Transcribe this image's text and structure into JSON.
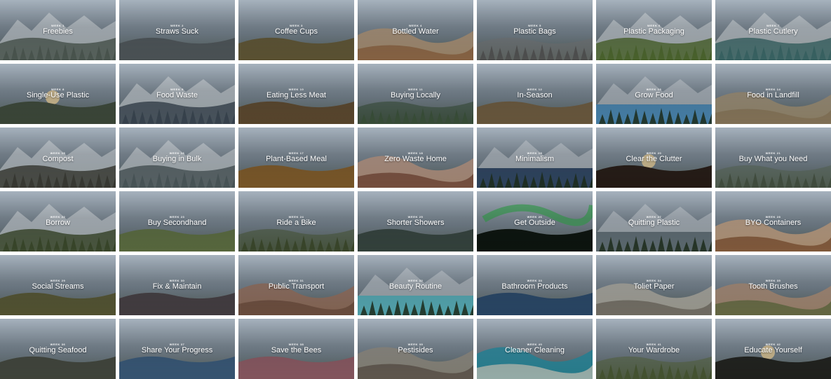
{
  "tiles": [
    {
      "week": "WEEK 1",
      "title": "Freebies",
      "scene": "snow-peaks",
      "colors": [
        "#b9c6d3",
        "#7c8a96",
        "#4f5b54"
      ]
    },
    {
      "week": "WEEK 2",
      "title": "Straws Suck",
      "scene": "foggy-lake",
      "colors": [
        "#dfe3e6",
        "#9aa5ab",
        "#2e3437"
      ]
    },
    {
      "week": "WEEK 3",
      "title": "Coffee Cups",
      "scene": "valley-road",
      "colors": [
        "#8fa6b0",
        "#7e7a4a",
        "#5a4a2a"
      ]
    },
    {
      "week": "WEEK 4",
      "title": "Bottled Water",
      "scene": "desert-hoodoo",
      "colors": [
        "#4f7ca6",
        "#c9a27a",
        "#8b5e3b"
      ]
    },
    {
      "week": "WEEK 5",
      "title": "Plastic Bags",
      "scene": "bw-forest",
      "colors": [
        "#d2d2d2",
        "#7b7b7b",
        "#2a2a2a"
      ]
    },
    {
      "week": "WEEK 6",
      "title": "Plastic Packaging",
      "scene": "mountain-meadow",
      "colors": [
        "#8eb6d8",
        "#7a8a96",
        "#4f6a2e"
      ]
    },
    {
      "week": "WEEK 7",
      "title": "Plastic Cutlery",
      "scene": "mountain-river",
      "colors": [
        "#d6dde3",
        "#6f7e77",
        "#3b6a6a"
      ]
    },
    {
      "week": "WEEK 8",
      "title": "Single-Use Plastic",
      "scene": "beach-sunset",
      "colors": [
        "#d8c9b8",
        "#8fa4b2",
        "#3e4a3a"
      ]
    },
    {
      "week": "WEEK 9",
      "title": "Food Waste",
      "scene": "glacier",
      "colors": [
        "#a9c4de",
        "#e6ecf2",
        "#3a4652"
      ]
    },
    {
      "week": "WEEK 10",
      "title": "Eating Less Meat",
      "scene": "antler-field",
      "colors": [
        "#6f7a7a",
        "#8a6a43",
        "#4e3a22"
      ]
    },
    {
      "week": "WEEK 11",
      "title": "Buying Locally",
      "scene": "forest-reflection",
      "colors": [
        "#5f7a56",
        "#2f4a2e",
        "#4a5f4a"
      ]
    },
    {
      "week": "WEEK 12",
      "title": "In-Season",
      "scene": "autumn-tundra",
      "colors": [
        "#8f9a98",
        "#8a6a4a",
        "#6a5a3a"
      ]
    },
    {
      "week": "WEEK 13",
      "title": "Grow Food",
      "scene": "blue-lake",
      "colors": [
        "#c9d6e2",
        "#3f86b8",
        "#2d4a2a"
      ]
    },
    {
      "week": "WEEK 14",
      "title": "Food in Landfill",
      "scene": "badlands",
      "colors": [
        "#cfc6b2",
        "#b59d78",
        "#8a7658"
      ]
    },
    {
      "week": "WEEK 15",
      "title": "Compost",
      "scene": "rocky-peaks",
      "colors": [
        "#9ea8b0",
        "#6e6a66",
        "#3b3c35"
      ]
    },
    {
      "week": "WEEK 16",
      "title": "Buying in Bulk",
      "scene": "snow-range",
      "colors": [
        "#6f97c2",
        "#e3ebf2",
        "#4e5a5e"
      ]
    },
    {
      "week": "WEEK 17",
      "title": "Plant-Based Meal",
      "scene": "golden-aspen",
      "colors": [
        "#a7b7c4",
        "#c78a32",
        "#6a4a22"
      ]
    },
    {
      "week": "WEEK 18",
      "title": "Zero Waste Home",
      "scene": "hot-spring",
      "colors": [
        "#b8563a",
        "#d6a58a",
        "#6e3e2e"
      ]
    },
    {
      "week": "WEEK 19",
      "title": "Minimalism",
      "scene": "still-lake",
      "colors": [
        "#3a78b8",
        "#203a5a",
        "#9ec0df"
      ]
    },
    {
      "week": "WEEK 20",
      "title": "Clear the Clutter",
      "scene": "sunset-hills",
      "colors": [
        "#d79a52",
        "#5a3320",
        "#231610"
      ]
    },
    {
      "week": "WEEK 21",
      "title": "Buy What you Need",
      "scene": "misty-marsh",
      "colors": [
        "#c6c9c7",
        "#5b6b55",
        "#2f3a2e"
      ]
    },
    {
      "week": "WEEK 22",
      "title": "Borrow",
      "scene": "fall-valley",
      "colors": [
        "#a9c3dd",
        "#8a7a4a",
        "#3b4a2a"
      ]
    },
    {
      "week": "WEEK 23",
      "title": "Buy Secondhand",
      "scene": "green-slope",
      "colors": [
        "#4a6fa8",
        "#6e6a68",
        "#5b7a2e"
      ]
    },
    {
      "week": "WEEK 24",
      "title": "Ride a Bike",
      "scene": "canyon-forest",
      "colors": [
        "#6e7a6e",
        "#4a5a32",
        "#2e3a22"
      ]
    },
    {
      "week": "WEEK 25",
      "title": "Shorter Showers",
      "scene": "canyon-stream",
      "colors": [
        "#8a8a7e",
        "#4e5a52",
        "#2a3a36"
      ]
    },
    {
      "week": "WEEK 26",
      "title": "Get Outside",
      "scene": "aurora",
      "colors": [
        "#1d4a2a",
        "#3fae5a",
        "#0e1a12"
      ]
    },
    {
      "week": "WEEK 27",
      "title": "Quitting Plastic",
      "scene": "mountain-lake",
      "colors": [
        "#9ab0c6",
        "#5a6a72",
        "#2e3a2e"
      ]
    },
    {
      "week": "WEEK 28",
      "title": "BYO Containers",
      "scene": "terraces",
      "colors": [
        "#c8743a",
        "#e2b48a",
        "#7a4a2a"
      ]
    },
    {
      "week": "WEEK 29",
      "title": "Social Streams",
      "scene": "river-gorge",
      "colors": [
        "#8e9aa4",
        "#9a7a3a",
        "#3a4a2e"
      ]
    },
    {
      "week": "WEEK 30",
      "title": "Fix & Maintain",
      "scene": "dusk-ridge",
      "colors": [
        "#a9b2c2",
        "#7a4a3a",
        "#2e3a4a"
      ]
    },
    {
      "week": "WEEK 31",
      "title": "Public Transport",
      "scene": "rock-tower",
      "colors": [
        "#c2c8cc",
        "#a8735a",
        "#6a4a3a"
      ]
    },
    {
      "week": "WEEK 32",
      "title": "Beauty Routine",
      "scene": "turquoise-lake",
      "colors": [
        "#7ea6cf",
        "#4fb4c0",
        "#2a4a2a"
      ]
    },
    {
      "week": "WEEK 33",
      "title": "Bathroom Products",
      "scene": "aerial-snow",
      "colors": [
        "#e4ecf4",
        "#3e6a9a",
        "#1e3a5a"
      ]
    },
    {
      "week": "WEEK 34",
      "title": "Toliet Paper",
      "scene": "grey-badlands",
      "colors": [
        "#8a94a8",
        "#c9c2b4",
        "#6a645a"
      ]
    },
    {
      "week": "WEEK 35",
      "title": "Tooth Brushes",
      "scene": "cliff-face",
      "colors": [
        "#9ab0c6",
        "#c49a7a",
        "#5a6a3a"
      ]
    },
    {
      "week": "WEEK 36",
      "title": "Quitting Seafood",
      "scene": "rocky-shore",
      "colors": [
        "#a8aeae",
        "#5a5e52",
        "#3a3e34"
      ]
    },
    {
      "week": "WEEK 37",
      "title": "Share Your Progress",
      "scene": "ice-cave",
      "colors": [
        "#a8cae6",
        "#5a86b0",
        "#2a4a6a"
      ]
    },
    {
      "week": "WEEK 38",
      "title": "Save the Bees",
      "scene": "wildflowers",
      "colors": [
        "#8aa0b2",
        "#6a8a4a",
        "#b04a7a"
      ]
    },
    {
      "week": "WEEK 39",
      "title": "Pestisides",
      "scene": "striped-hills",
      "colors": [
        "#8e9aa6",
        "#a49a8a",
        "#5a4e46"
      ]
    },
    {
      "week": "WEEK 40",
      "title": "Cleaner Cleaning",
      "scene": "geyser-pool",
      "colors": [
        "#7ab0d6",
        "#1a9ab4",
        "#dcd6c8"
      ]
    },
    {
      "week": "WEEK 41",
      "title": "Your Wardrobe",
      "scene": "mossy-forest",
      "colors": [
        "#b0b89a",
        "#5a6a3a",
        "#3a4a2a"
      ]
    },
    {
      "week": "WEEK 42",
      "title": "Educate Yourself",
      "scene": "misty-sunrise",
      "colors": [
        "#cfc0a2",
        "#6a6250",
        "#1e1e1a"
      ]
    }
  ]
}
